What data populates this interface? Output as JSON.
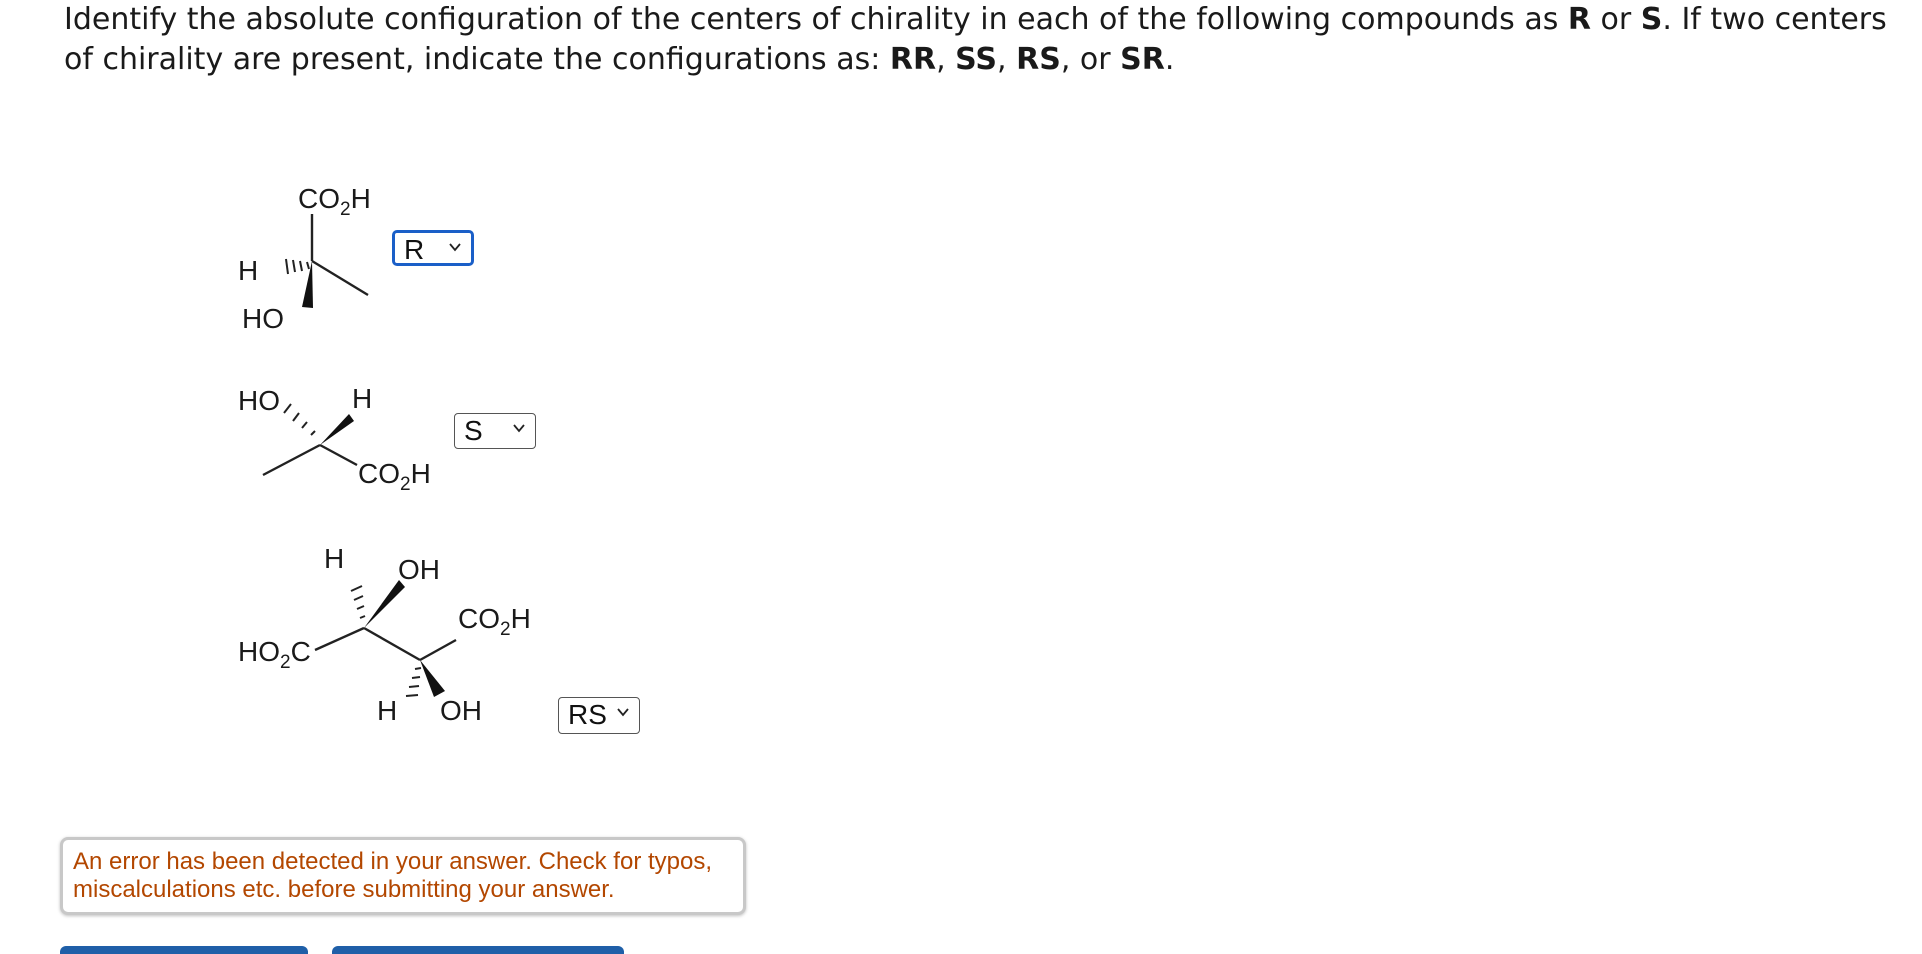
{
  "question": {
    "part1": "Identify the absolute configuration of the centers of chirality in each of the following compounds as ",
    "r": "R",
    "or1": " or ",
    "s": "S",
    "part2": ". If two centers of chirality are present, indicate the configurations as: ",
    "rr": "RR",
    "sep1": ", ",
    "ss": "SS",
    "sep2": ", ",
    "rs": "RS",
    "sep3": ", or ",
    "sr": "SR",
    "end": "."
  },
  "molecules": {
    "m1": {
      "co": "CO",
      "two": "2",
      "h": "H",
      "hleft": "H",
      "ho": "HO"
    },
    "m2": {
      "ho": "HO",
      "h": "H",
      "co": "CO",
      "two": "2",
      "hend": "H"
    },
    "m3": {
      "htop": "H",
      "oh_top": "OH",
      "co": "CO",
      "two": "2",
      "hend": "H",
      "ho": "HO",
      "two_b": "2",
      "c": "C",
      "hbottom": "H",
      "oh_bottom": "OH"
    }
  },
  "answers": [
    {
      "value": "R",
      "focused": true
    },
    {
      "value": "S",
      "focused": false
    },
    {
      "value": "RS",
      "focused": false
    }
  ],
  "feedback": {
    "error": "An error has been detected in your answer. Check for typos, miscalculations etc. before submitting your answer."
  },
  "colors": {
    "focus": "#1a5fc8",
    "error_text": "#b34700",
    "button": "#1f5fa8"
  }
}
